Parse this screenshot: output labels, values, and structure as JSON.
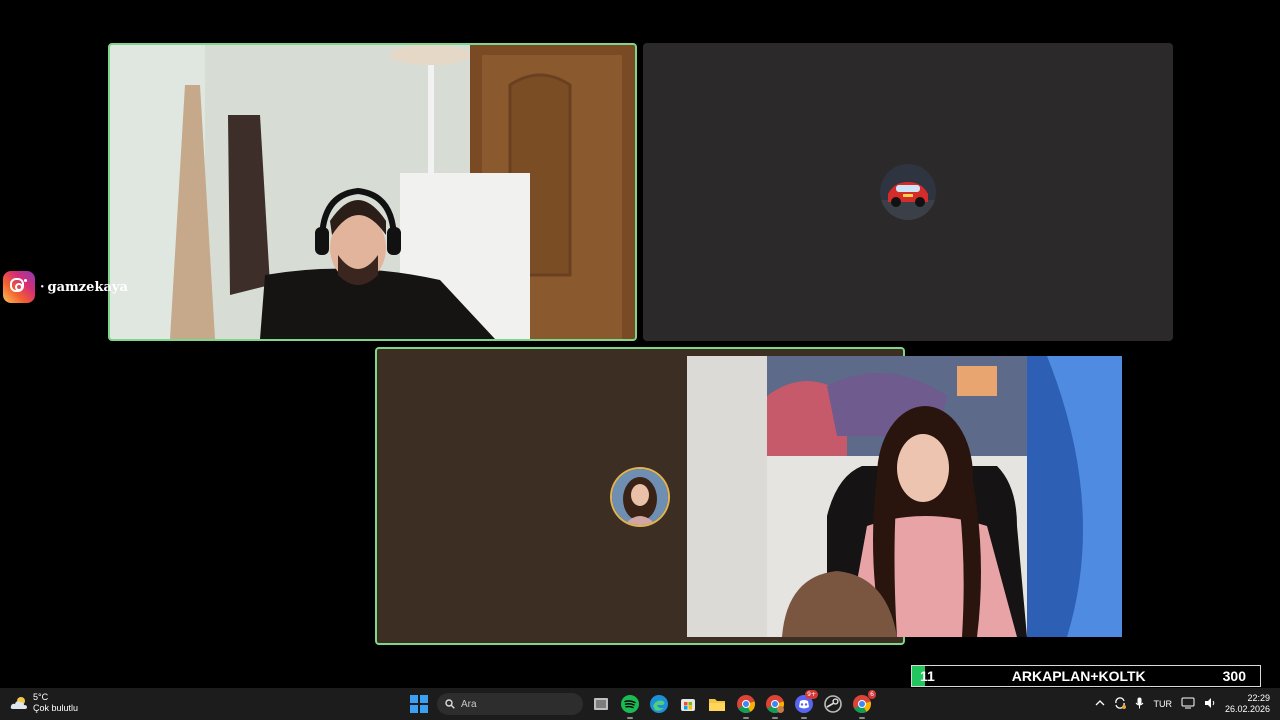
{
  "meeting": {
    "participants": [
      {
        "tile": "camera",
        "speaking": true
      },
      {
        "tile": "avatar",
        "avatar_icon": "red-race-car"
      },
      {
        "tile": "avatar",
        "avatar_icon": "woman-portrait",
        "speaking": true
      }
    ]
  },
  "instagram_overlay": {
    "icon": "instagram-icon",
    "separator": "·",
    "handle": "gamzekaya"
  },
  "goal_bar": {
    "current": "11",
    "label": "ARKAPLAN+KOLTK",
    "target": "300",
    "progress_fraction": 0.037,
    "fill_color": "#22c55e"
  },
  "taskbar": {
    "weather": {
      "temperature": "5°C",
      "condition": "Çok bulutlu"
    },
    "search_placeholder": "Ara",
    "apps": [
      "windows-start",
      "file-explorer-task-view",
      "spotify",
      "edge",
      "microsoft-store",
      "file-explorer",
      "chrome",
      "chrome-profile",
      "discord",
      "steam",
      "chrome-active"
    ],
    "discord_badge": "9+",
    "chrome_badge": "6",
    "tray": {
      "language": "TUR",
      "time": "22:29",
      "date": "26.02.2026"
    }
  }
}
